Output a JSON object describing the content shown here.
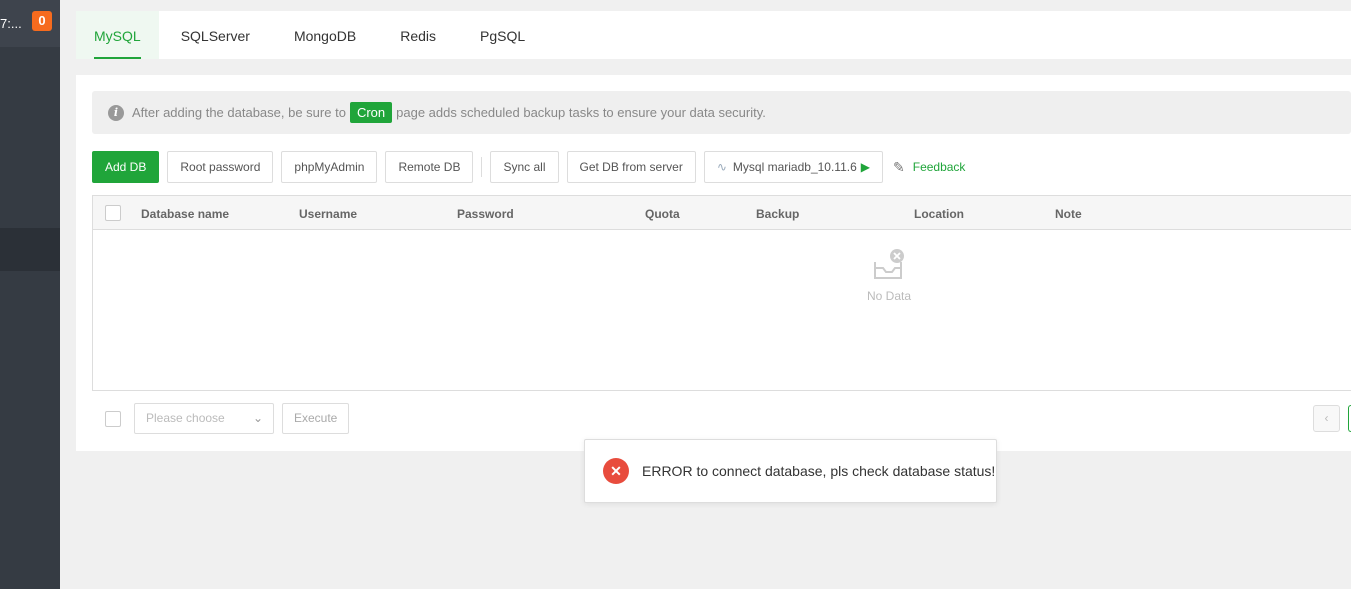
{
  "sidebar": {
    "top_text": "7:...",
    "badge": "0"
  },
  "tabs": [
    "MySQL",
    "SQLServer",
    "MongoDB",
    "Redis",
    "PgSQL"
  ],
  "notice": {
    "before": "After adding the database, be sure to",
    "link": "Cron",
    "after": "page adds scheduled backup tasks to ensure your data security."
  },
  "toolbar": {
    "add_db": "Add DB",
    "root_password": "Root password",
    "phpmyadmin": "phpMyAdmin",
    "remote_db": "Remote DB",
    "sync_all": "Sync all",
    "get_db": "Get DB from server",
    "version": "Mysql mariadb_10.11.6",
    "feedback": "Feedback"
  },
  "table": {
    "columns": [
      "Database name",
      "Username",
      "Password",
      "Quota",
      "Backup",
      "Location",
      "Note"
    ],
    "empty": "No Data"
  },
  "footer": {
    "placeholder": "Please choose",
    "execute": "Execute"
  },
  "toast": {
    "message": "ERROR to connect database, pls check database status!"
  }
}
